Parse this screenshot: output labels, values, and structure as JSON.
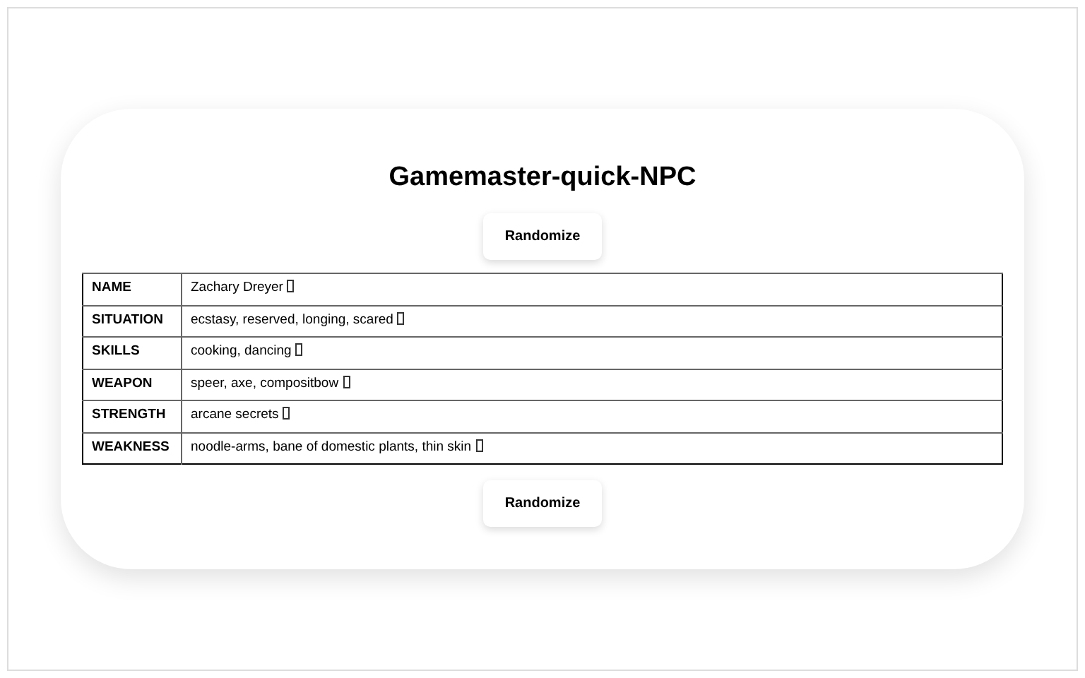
{
  "title": "Gamemaster-quick-NPC",
  "buttons": [
    "Randomize",
    "Randomize"
  ],
  "rows": [
    {
      "label": "NAME",
      "value": "Zachary Dreyer"
    },
    {
      "label": "SITUATION",
      "value": "ecstasy, reserved, longing, scared"
    },
    {
      "label": "SKILLS",
      "value": "cooking, dancing"
    },
    {
      "label": "WEAPON",
      "value": "speer, axe, compositbow"
    },
    {
      "label": "STRENGTH",
      "value": "arcane secrets"
    },
    {
      "label": "WEAKNESS",
      "value": "noodle-arms, bane of domestic plants, thin skin"
    }
  ]
}
